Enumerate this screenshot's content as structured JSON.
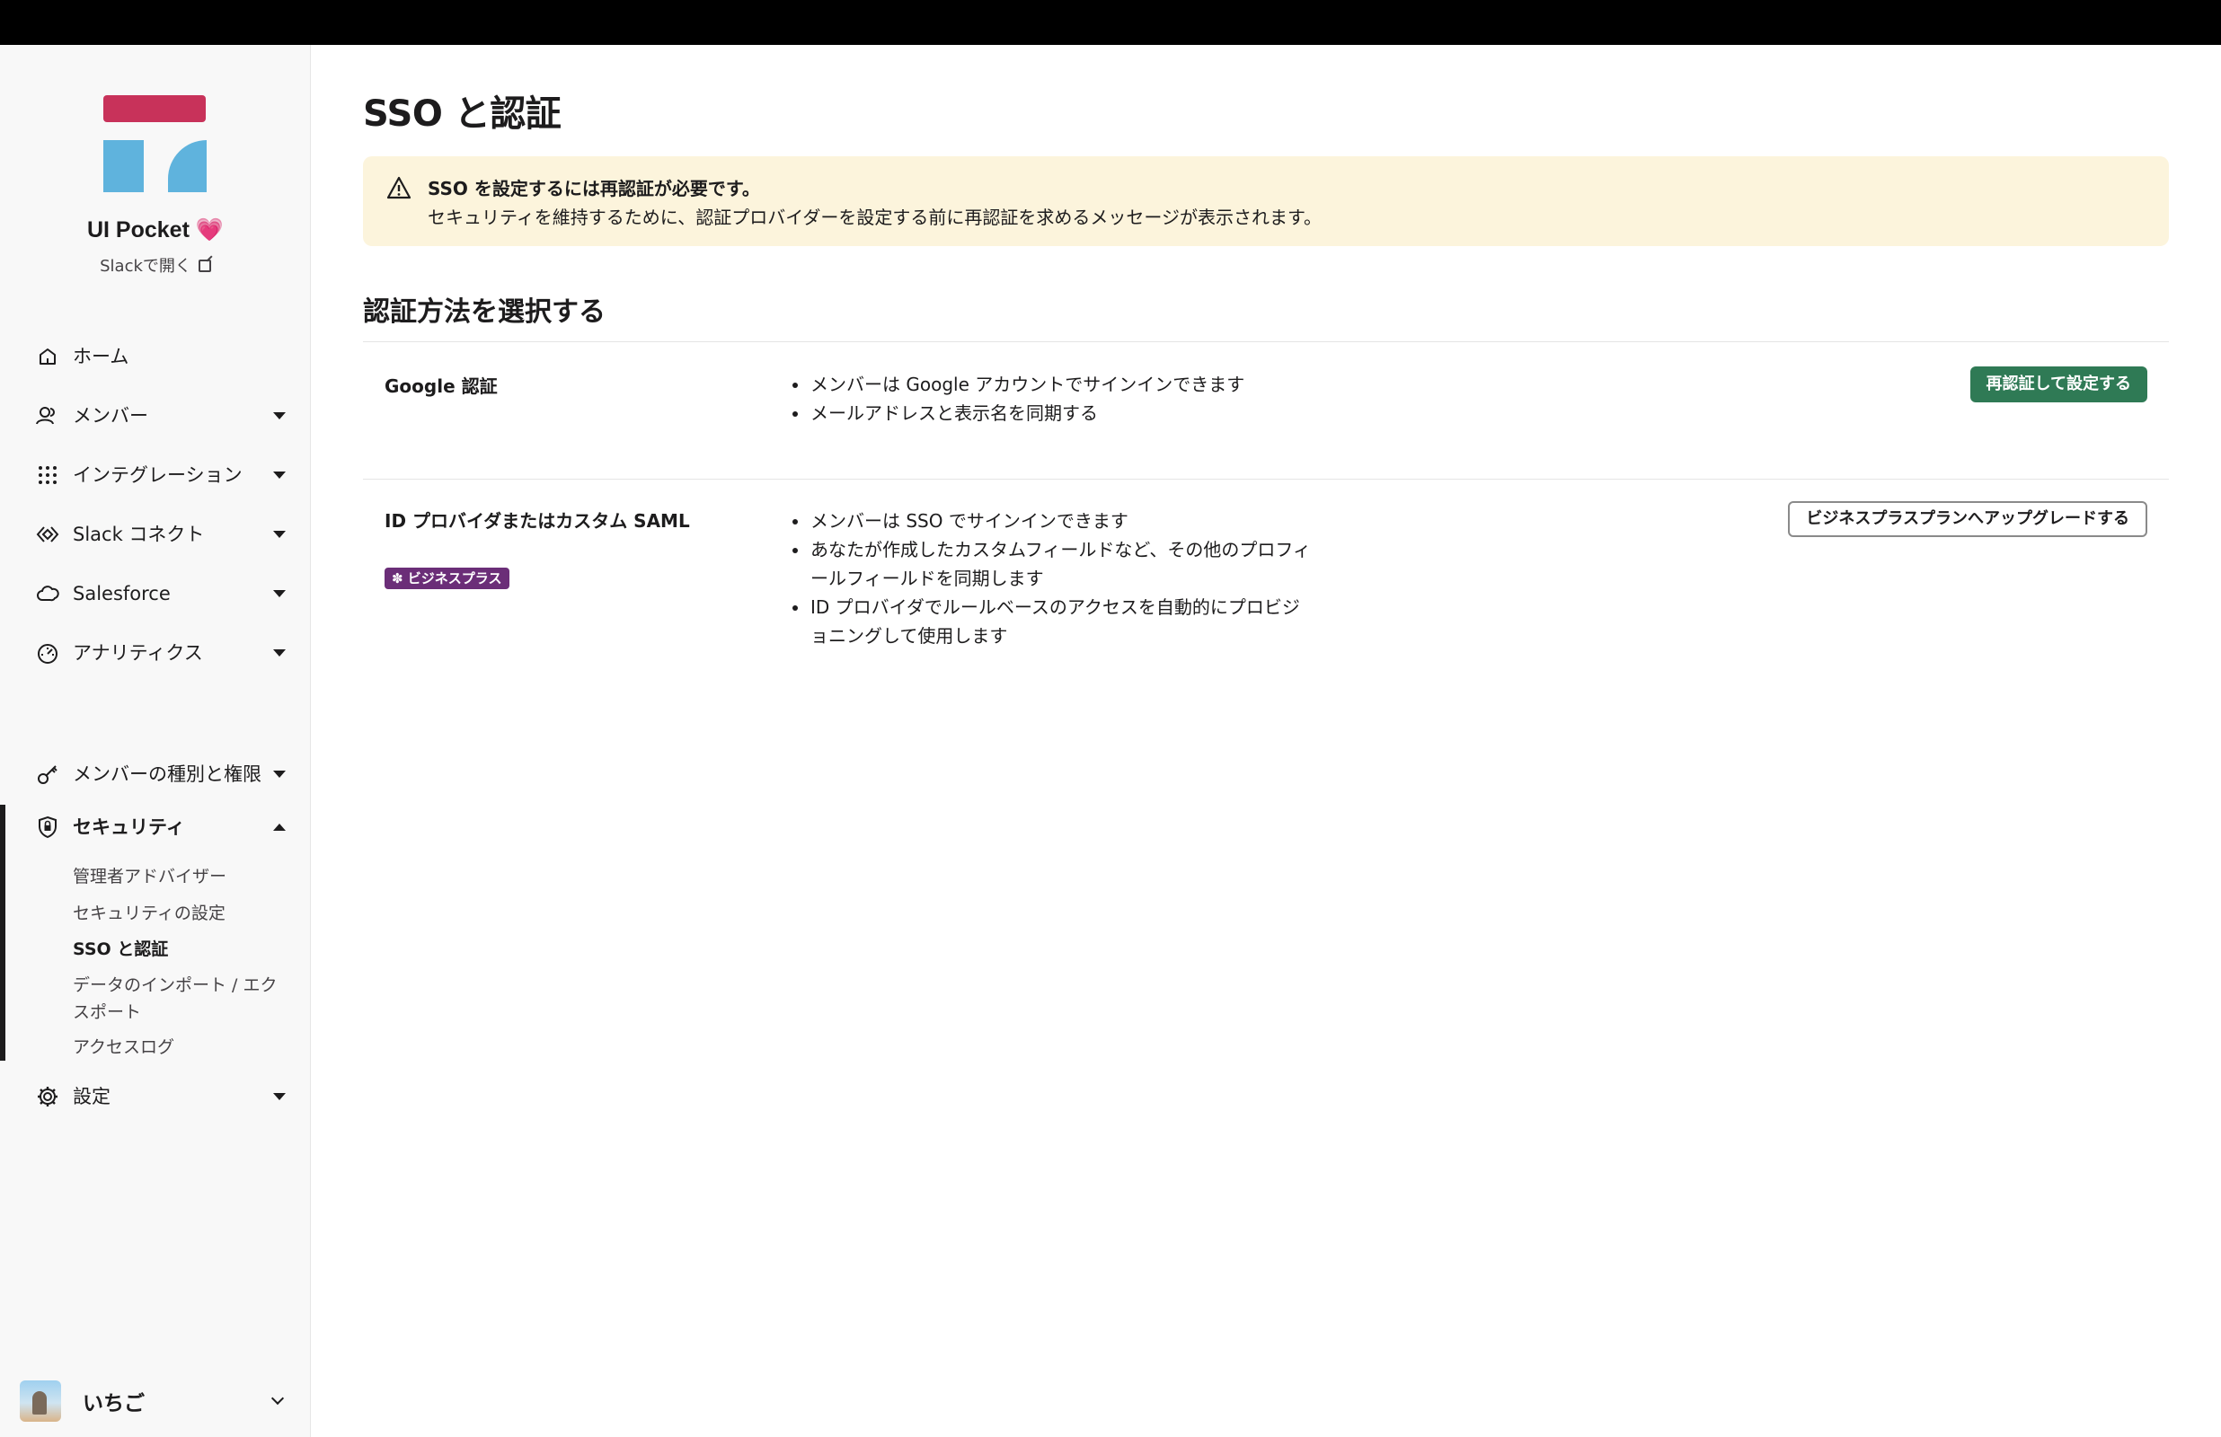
{
  "workspace": {
    "name": "UI Pocket",
    "heart": "💗",
    "open_in_slack": "Slackで開く"
  },
  "nav": {
    "home": "ホーム",
    "members": "メンバー",
    "integrations": "インテグレーション",
    "slack_connect": "Slack コネクト",
    "salesforce": "Salesforce",
    "analytics": "アナリティクス",
    "member_types": "メンバーの種別と権限",
    "security": "セキュリティ",
    "settings": "設定"
  },
  "security_sub": {
    "admin_advisor": "管理者アドバイザー",
    "security_settings": "セキュリティの設定",
    "sso_auth": "SSO と認証",
    "data_import_export": "データのインポート / エクスポート",
    "access_logs": "アクセスログ"
  },
  "user": {
    "name": "いちご"
  },
  "page": {
    "title": "SSO と認証",
    "alert_title": "SSO を設定するには再認証が必要です。",
    "alert_body": "セキュリティを維持するために、認証プロバイダーを設定する前に再認証を求めるメッセージが表示されます。",
    "section_title": "認証方法を選択する"
  },
  "methods": {
    "google": {
      "title": "Google 認証",
      "bullets": [
        "メンバーは Google アカウントでサインインできます",
        "メールアドレスと表示名を同期する"
      ],
      "button": "再認証して設定する"
    },
    "saml": {
      "title": "ID プロバイダまたはカスタム SAML",
      "badge": "ビジネスプラス",
      "bullets": [
        "メンバーは SSO でサインインできます",
        "あなたが作成したカスタムフィールドなど、その他のプロフィールフィールドを同期します",
        "ID プロバイダでルールベースのアクセスを自動的にプロビジョニングして使用します"
      ],
      "button": "ビジネスプラスプランへアップグレードする"
    }
  },
  "colors": {
    "brand_red": "#c8325a",
    "brand_blue": "#5fb3dd",
    "primary_green": "#2f7a55",
    "alert_bg": "#fcf4dc",
    "badge_purple": "#6b2e78"
  }
}
